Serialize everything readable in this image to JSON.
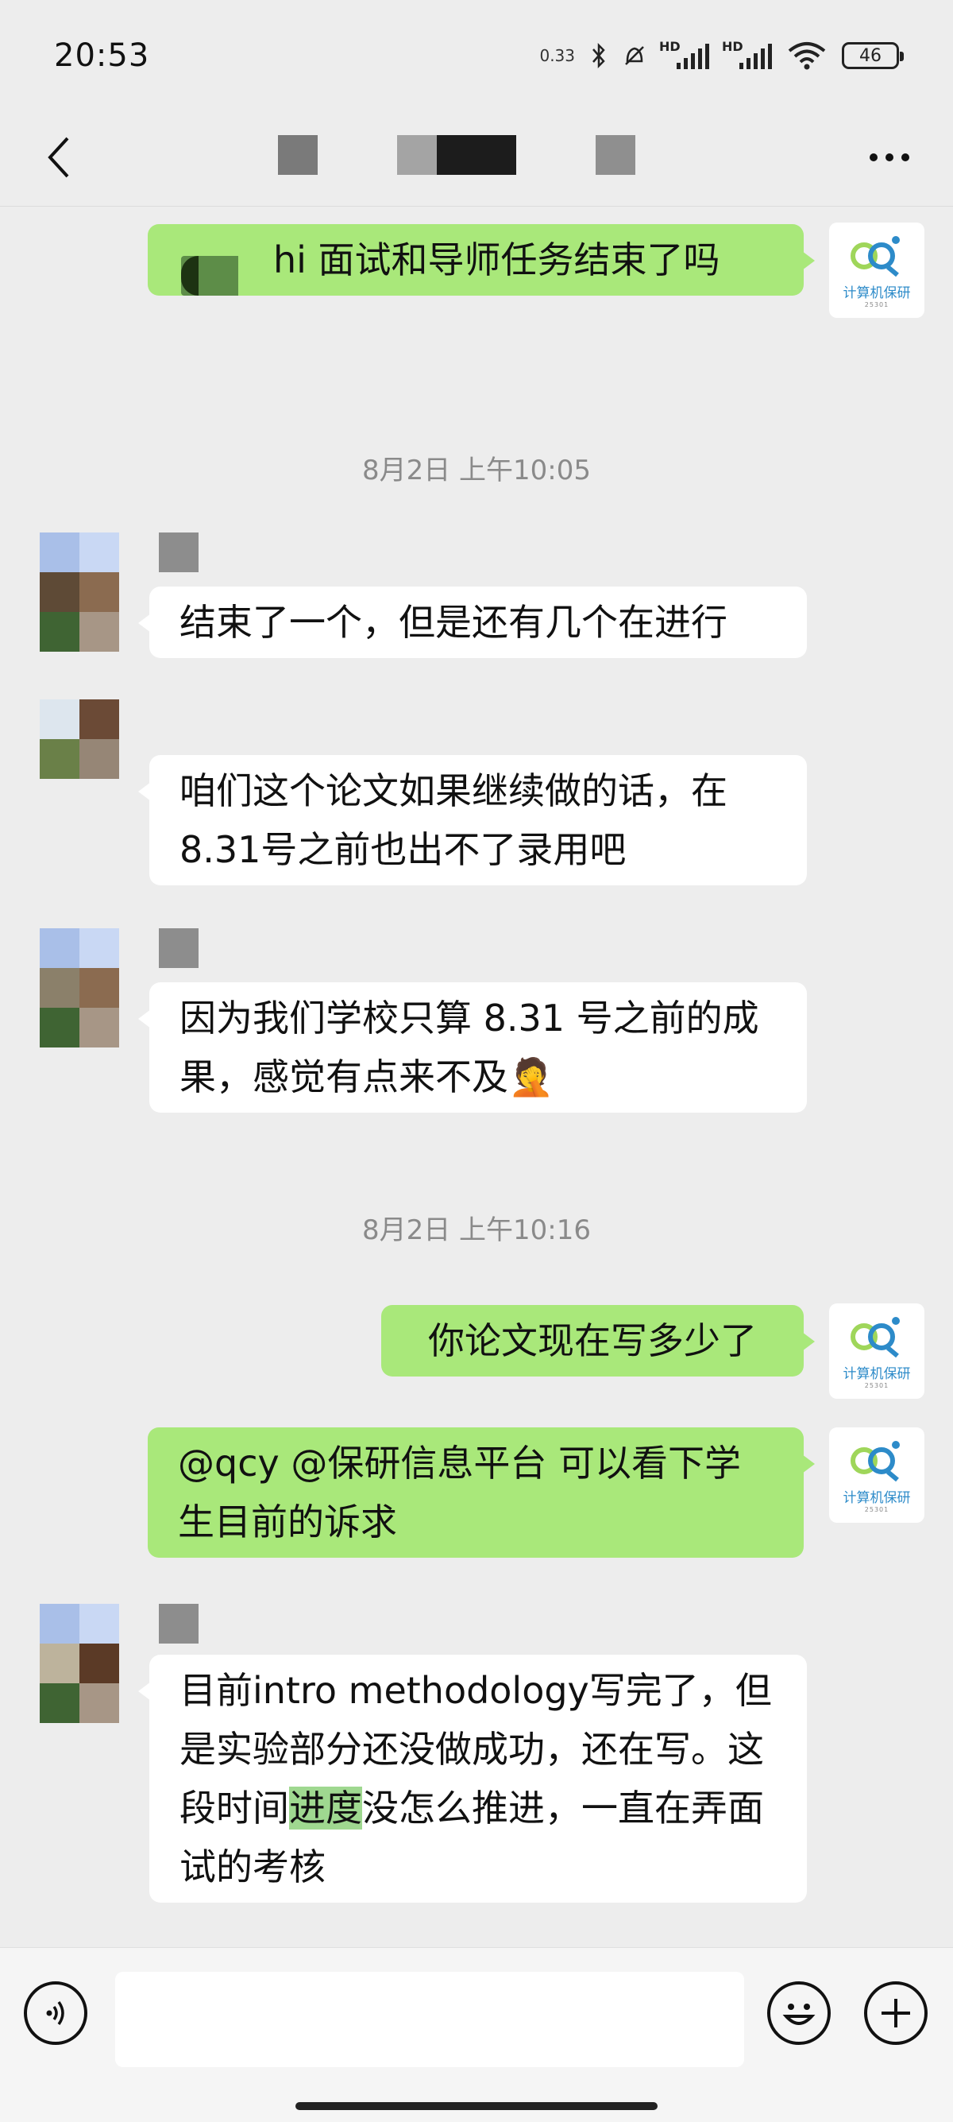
{
  "status_bar": {
    "time": "20:53",
    "net_speed": "0.33",
    "signal_1_label": "HD",
    "signal_2_label": "HD",
    "battery_level": "46"
  },
  "nav": {
    "back_icon": "chevron-left-icon",
    "more_icon": "more-dots-icon"
  },
  "self_avatar": {
    "logo_text": "计算机保研",
    "logo_sub": "25301"
  },
  "messages": [
    {
      "side": "out",
      "text": "hi 面试和导师任务结束了吗"
    },
    {
      "type": "timestamp",
      "text": "8月2日 上午10:05"
    },
    {
      "side": "in",
      "text": "结束了一个，但是还有几个在进行"
    },
    {
      "side": "in",
      "text": "咱们这个论文如果继续做的话，在8.31号之前也出不了录用吧"
    },
    {
      "side": "in",
      "text": "因为我们学校只算 8.31 号之前的成果，感觉有点来不及🤦"
    },
    {
      "type": "timestamp",
      "text": "8月2日 上午10:16"
    },
    {
      "side": "out",
      "text": "你论文现在写多少了"
    },
    {
      "side": "out",
      "text": "@qcy @保研信息平台  可以看下学生目前的诉求"
    },
    {
      "side": "in",
      "text_before": "目前intro methodology写完了，但是实验部分还没做成功，还在写。这段时间",
      "text_highlight": "进度",
      "text_after": "没怎么推进，一直在弄面试的考核"
    }
  ],
  "input_bar": {
    "placeholder": "",
    "voice_icon": "voice-icon",
    "emoji_icon": "emoji-icon",
    "plus_icon": "plus-icon"
  },
  "colors": {
    "background": "#ededed",
    "outgoing_bubble": "#a9e87a",
    "incoming_bubble": "#ffffff",
    "highlight": "#9fd890"
  }
}
